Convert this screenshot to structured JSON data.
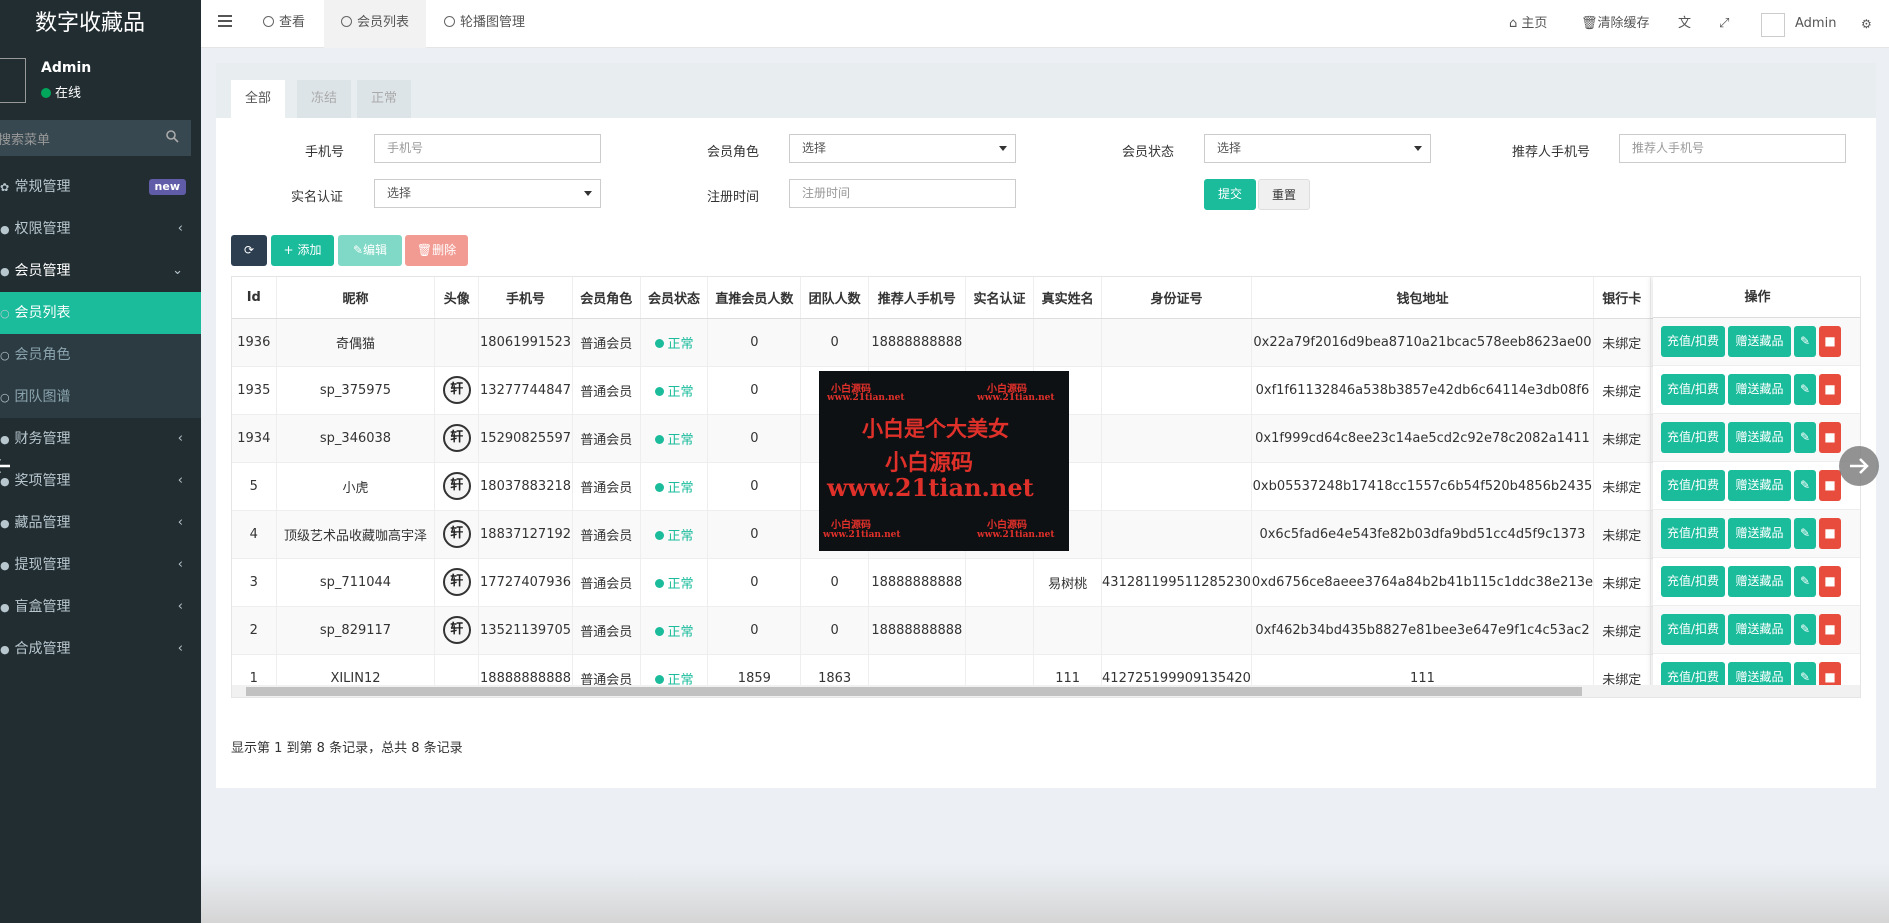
{
  "app": {
    "title": "数字收藏品"
  },
  "user": {
    "name": "Admin",
    "status": "在线"
  },
  "sidebar": {
    "search_placeholder": "搜索菜单",
    "items": [
      {
        "label": "常规管理",
        "badge": "new"
      },
      {
        "label": "权限管理",
        "arrow": "‹"
      },
      {
        "label": "会员管理",
        "arrow": "⌄"
      },
      {
        "label": "会员列表"
      },
      {
        "label": "会员角色"
      },
      {
        "label": "团队图谱"
      },
      {
        "label": "财务管理",
        "arrow": "‹"
      },
      {
        "label": "奖项管理",
        "arrow": "‹"
      },
      {
        "label": "藏品管理",
        "arrow": "‹"
      },
      {
        "label": "提现管理",
        "arrow": "‹"
      },
      {
        "label": "盲盒管理",
        "arrow": "‹"
      },
      {
        "label": "合成管理",
        "arrow": "‹"
      }
    ]
  },
  "topbar": {
    "tabs": [
      "查看",
      "会员列表",
      "轮播图管理"
    ],
    "home": "主页",
    "clear_cache": "清除缓存",
    "admin": "Admin"
  },
  "filter_tabs": [
    "全部",
    "冻结",
    "正常"
  ],
  "filters": {
    "phone_label": "手机号",
    "phone_placeholder": "手机号",
    "role_label": "会员角色",
    "role_value": "选择",
    "status_label": "会员状态",
    "status_value": "选择",
    "referrer_label": "推荐人手机号",
    "referrer_placeholder": "推荐人手机号",
    "realname_label": "实名认证",
    "realname_value": "选择",
    "regtime_label": "注册时间",
    "regtime_placeholder": "注册时间",
    "submit": "提交",
    "reset": "重置"
  },
  "toolbar": {
    "add": "添加",
    "edit": "编辑",
    "delete": "删除"
  },
  "table": {
    "columns": [
      "Id",
      "昵称",
      "头像",
      "手机号",
      "会员角色",
      "会员状态",
      "直推会员人数",
      "团队人数",
      "推荐人手机号",
      "实名认证",
      "真实姓名",
      "身份证号",
      "钱包地址",
      "银行卡"
    ],
    "ops_header": "操作",
    "ops_recharge": "充值/扣费",
    "ops_gift": "赠送藏品",
    "rows": [
      {
        "id": "1936",
        "nick": "奇偶猫",
        "avatar": "",
        "phone": "18061991523",
        "role": "普通会员",
        "status": "正常",
        "direct": "0",
        "team": "0",
        "ref": "18888888888",
        "real": "",
        "name": "",
        "idno": "",
        "wallet": "0x22a79f2016d9bea8710a21bcac578eeb8623ae00",
        "bank": "未绑定"
      },
      {
        "id": "1935",
        "nick": "sp_375975",
        "avatar": "轩",
        "phone": "13277744847",
        "role": "普通会员",
        "status": "正常",
        "direct": "0",
        "team": "",
        "ref": "",
        "real": "",
        "name": "",
        "idno": "",
        "wallet": "0xf1f61132846a538b3857e42db6c64114e3db08f6",
        "bank": "未绑定"
      },
      {
        "id": "1934",
        "nick": "sp_346038",
        "avatar": "轩",
        "phone": "15290825597",
        "role": "普通会员",
        "status": "正常",
        "direct": "0",
        "team": "",
        "ref": "",
        "real": "",
        "name": "",
        "idno": "",
        "wallet": "0x1f999cd64c8ee23c14ae5cd2c92e78c2082a1411",
        "bank": "未绑定"
      },
      {
        "id": "5",
        "nick": "小虎",
        "avatar": "轩",
        "phone": "18037883218",
        "role": "普通会员",
        "status": "正常",
        "direct": "0",
        "team": "",
        "ref": "",
        "real": "",
        "name": "",
        "idno": "",
        "wallet": "0xb05537248b17418cc1557c6b54f520b4856b2435",
        "bank": "未绑定"
      },
      {
        "id": "4",
        "nick": "顶级艺术品收藏咖高宇泽",
        "avatar": "轩",
        "phone": "18837127192",
        "role": "普通会员",
        "status": "正常",
        "direct": "0",
        "team": "",
        "ref": "",
        "real": "",
        "name": "",
        "idno": "",
        "wallet": "0x6c5fad6e4e543fe82b03dfa9bd51cc4d5f9c1373",
        "bank": "未绑定"
      },
      {
        "id": "3",
        "nick": "sp_711044",
        "avatar": "轩",
        "phone": "17727407936",
        "role": "普通会员",
        "status": "正常",
        "direct": "0",
        "team": "0",
        "ref": "18888888888",
        "real": "",
        "name": "易树桃",
        "idno": "431281199511285230",
        "wallet": "0xd6756ce8aeee3764a84b2b41b115c1ddc38e213e",
        "bank": "未绑定"
      },
      {
        "id": "2",
        "nick": "sp_829117",
        "avatar": "轩",
        "phone": "13521139705",
        "role": "普通会员",
        "status": "正常",
        "direct": "0",
        "team": "0",
        "ref": "18888888888",
        "real": "",
        "name": "",
        "idno": "",
        "wallet": "0xf462b34bd435b8827e81bee3e647e9f1c4c53ac2",
        "bank": "未绑定"
      },
      {
        "id": "1",
        "nick": "XILIN12",
        "avatar": "",
        "phone": "18888888888",
        "role": "普通会员",
        "status": "正常",
        "direct": "1859",
        "team": "1863",
        "ref": "",
        "real": "",
        "name": "111",
        "idno": "412725199909135420",
        "wallet": "111",
        "bank": "未绑定"
      }
    ]
  },
  "footer_info": "显示第 1 到第 8 条记录，总共 8 条记录",
  "watermark": {
    "small_a": "小白源码",
    "small_b": "www.21tian.net",
    "line1": "小白是个大美女",
    "line2": "小白源码",
    "line3": "www.21tian.net"
  },
  "colors": {
    "primary": "#1abc9c",
    "sidebar": "#222d32",
    "danger": "#e74c3c",
    "dark": "#2c3e50"
  }
}
